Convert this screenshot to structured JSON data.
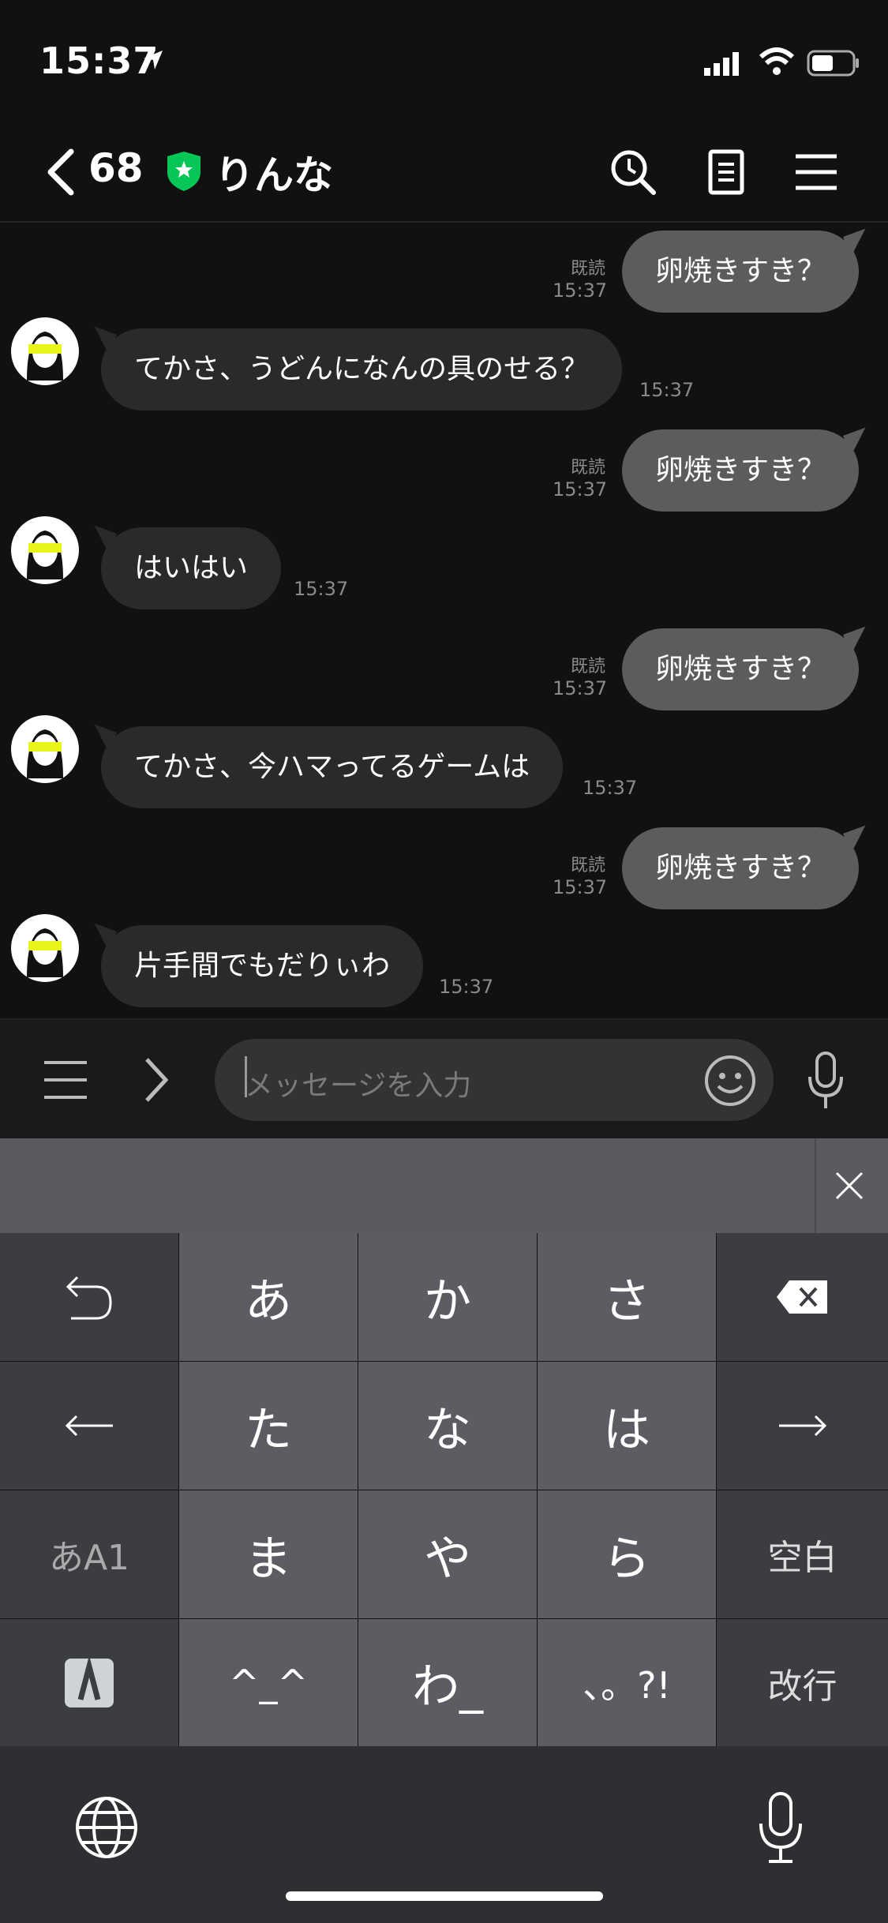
{
  "status": {
    "time": "15:37"
  },
  "nav": {
    "back_count": "68",
    "title": "りんな"
  },
  "messages": [
    {
      "dir": "out",
      "text": "卵焼きすき？",
      "read": "既読",
      "time": "15:37"
    },
    {
      "dir": "in",
      "text": "てかさ、うどんになんの具のせる？",
      "time": "15:37"
    },
    {
      "dir": "out",
      "text": "卵焼きすき？",
      "read": "既読",
      "time": "15:37"
    },
    {
      "dir": "in",
      "text": "はいはい",
      "time": "15:37"
    },
    {
      "dir": "out",
      "text": "卵焼きすき？",
      "read": "既読",
      "time": "15:37"
    },
    {
      "dir": "in",
      "text": "てかさ、今ハマってるゲームは",
      "time": "15:37"
    },
    {
      "dir": "out",
      "text": "卵焼きすき？",
      "read": "既読",
      "time": "15:37"
    },
    {
      "dir": "in",
      "text": "片手間でもだりぃわ",
      "time": "15:37"
    }
  ],
  "input": {
    "placeholder": "メッセージを入力"
  },
  "keyboard": {
    "row1": [
      "あ",
      "か",
      "さ"
    ],
    "row2": [
      "た",
      "な",
      "は"
    ],
    "row3": [
      "ま",
      "や",
      "ら"
    ],
    "row4": [
      "^_^",
      "わ_",
      "、。?!"
    ],
    "mode_label": "あA1",
    "space_label": "空白",
    "return_label": "改行"
  },
  "colors": {
    "accent_green": "#06c755",
    "bubble_out": "#5c5c5c",
    "bubble_in": "#2a2a2a"
  }
}
